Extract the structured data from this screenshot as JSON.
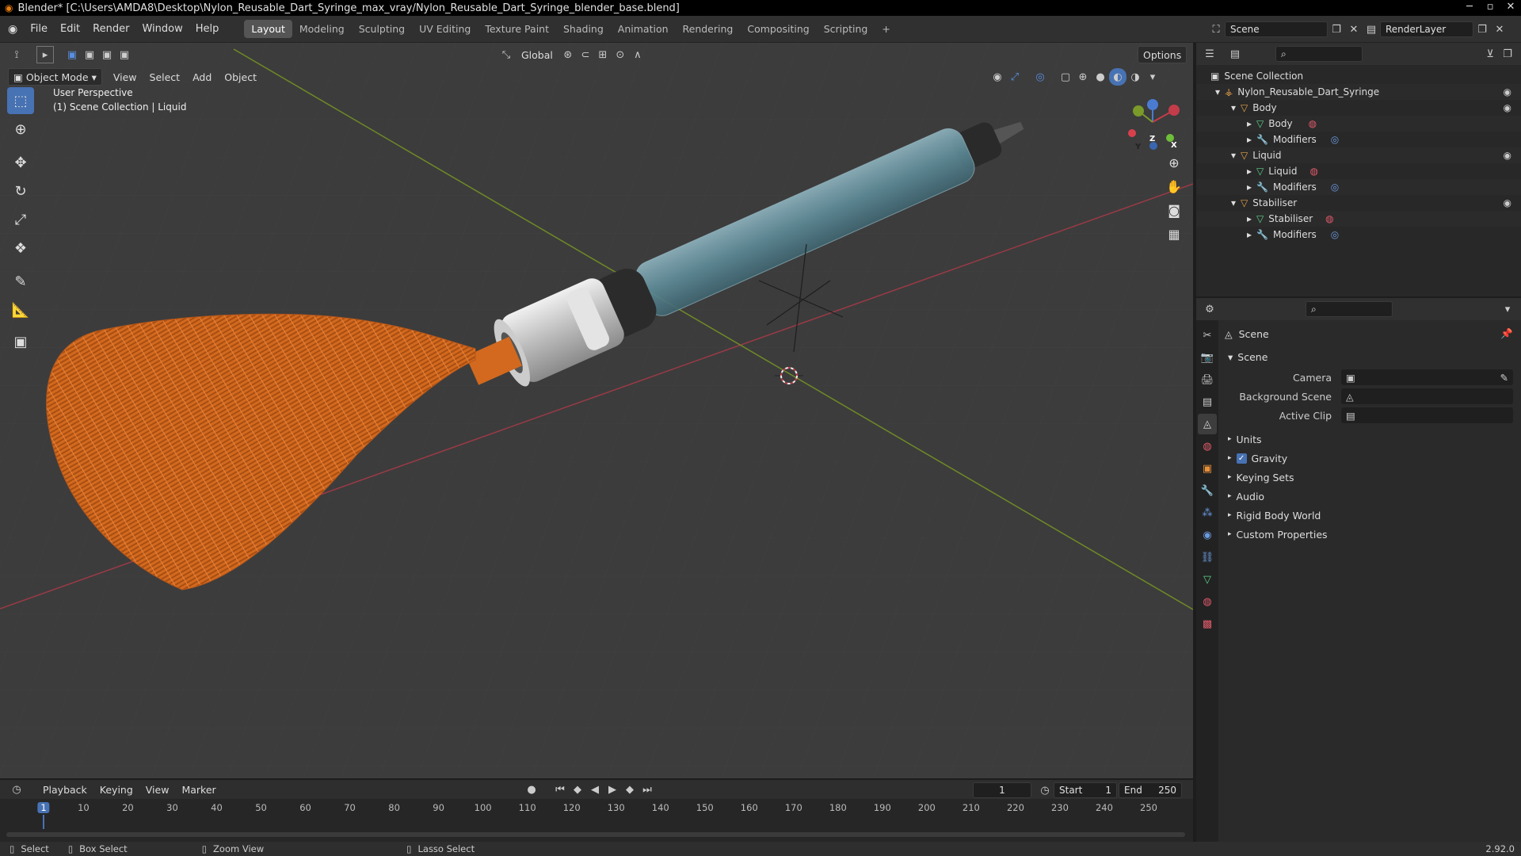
{
  "titlebar": {
    "title": "Blender* [C:\\Users\\AMDA8\\Desktop\\Nylon_Reusable_Dart_Syringe_max_vray/Nylon_Reusable_Dart_Syringe_blender_base.blend]"
  },
  "menu": {
    "file": "File",
    "edit": "Edit",
    "render": "Render",
    "window": "Window",
    "help": "Help"
  },
  "workspaces": [
    "Layout",
    "Modeling",
    "Sculpting",
    "UV Editing",
    "Texture Paint",
    "Shading",
    "Animation",
    "Rendering",
    "Compositing",
    "Scripting"
  ],
  "topbar": {
    "scene": "Scene",
    "view_layer": "RenderLayer",
    "add_tab": "+"
  },
  "viewport": {
    "mode": "Object Mode",
    "menus": {
      "view": "View",
      "select": "Select",
      "add": "Add",
      "object": "Object"
    },
    "transform_orientation": "Global",
    "options": "Options",
    "info_line1": "User Perspective",
    "info_line2": "(1) Scene Collection | Liquid",
    "gizmo": {
      "x": "X",
      "y": "Y",
      "z": "Z"
    }
  },
  "outliner": {
    "root": "Scene Collection",
    "items": [
      {
        "label": "Nylon_Reusable_Dart_Syringe",
        "indent": 1
      },
      {
        "label": "Body",
        "indent": 2
      },
      {
        "label": "Body",
        "indent": 3
      },
      {
        "label": "Modifiers",
        "indent": 3
      },
      {
        "label": "Liquid",
        "indent": 2
      },
      {
        "label": "Liquid",
        "indent": 3
      },
      {
        "label": "Modifiers",
        "indent": 3
      },
      {
        "label": "Stabiliser",
        "indent": 2
      },
      {
        "label": "Stabiliser",
        "indent": 3
      },
      {
        "label": "Modifiers",
        "indent": 3
      }
    ]
  },
  "properties": {
    "context": "Scene",
    "panel": "Scene",
    "camera_label": "Camera",
    "background_scene_label": "Background Scene",
    "active_clip_label": "Active Clip",
    "subpanels": [
      "Units",
      "Gravity",
      "Keying Sets",
      "Audio",
      "Rigid Body World",
      "Custom Properties"
    ]
  },
  "timeline": {
    "playback": "Playback",
    "keying": "Keying",
    "view": "View",
    "marker": "Marker",
    "current_frame": "1",
    "start_label": "Start",
    "start": "1",
    "end_label": "End",
    "end": "250",
    "ruler": [
      "1",
      "10",
      "20",
      "30",
      "40",
      "50",
      "60",
      "70",
      "80",
      "90",
      "100",
      "110",
      "120",
      "130",
      "140",
      "150",
      "160",
      "170",
      "180",
      "190",
      "200",
      "210",
      "220",
      "230",
      "240",
      "250"
    ]
  },
  "statusbar": {
    "select": "Select",
    "box_select": "Box Select",
    "zoom_view": "Zoom View",
    "lasso_select": "Lasso Select",
    "version": "2.92.0"
  },
  "colors": {
    "accent": "#4772b3",
    "x_axis": "#c33c4a",
    "y_axis": "#7a9a2a",
    "dart_tail": "#d2691e"
  }
}
